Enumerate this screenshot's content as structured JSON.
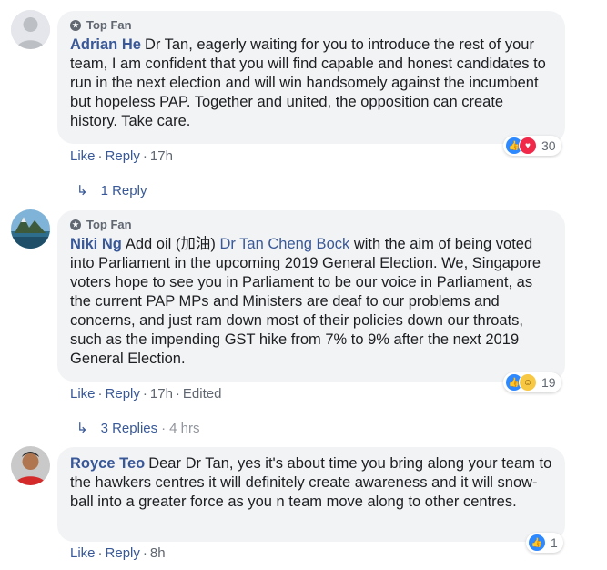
{
  "comments": [
    {
      "badge": "Top Fan",
      "author": "Adrian He",
      "text": "Dr Tan, eagerly waiting for you to introduce the rest of your team, I am confident that you will find capable and honest candidates to run in the next election and will win handsomely against the incumbent but hopeless PAP. Together and united, the opposition can create history. Take care.",
      "like": "Like",
      "reply": "Reply",
      "time": "17h",
      "reaction_count": "30",
      "replies_label": "1 Reply"
    },
    {
      "badge": "Top Fan",
      "author": "Niki Ng",
      "text_before": "Add oil (加油)",
      "mention": "Dr Tan Cheng Bock",
      "text_after": "with the aim of being voted into Parliament in the upcoming 2019 General Election. We, Singapore voters hope to see you in Parliament to be our voice in Parliament, as the current PAP MPs and Ministers are deaf to our problems and concerns, and just ram down most of their policies down our throats, such as the impending GST hike from 7% to 9% after the next 2019 General Election.",
      "like": "Like",
      "reply": "Reply",
      "time": "17h",
      "edited": "Edited",
      "reaction_count": "19",
      "replies_label": "3 Replies",
      "replies_time": "4 hrs"
    },
    {
      "author": "Royce Teo",
      "text": "Dear Dr Tan, yes it's about time you bring along your team to the hawkers centres it will definitely create awareness and it will snow-ball into a greater force as you n team move along to other centres.",
      "like": "Like",
      "reply": "Reply",
      "time": "8h",
      "reaction_count": "1"
    }
  ],
  "colors": {
    "link": "#385898",
    "bubble": "#f2f3f5",
    "meta": "#606770",
    "like": "#2e89ff",
    "love": "#f0284a",
    "haha": "#f7c844"
  }
}
